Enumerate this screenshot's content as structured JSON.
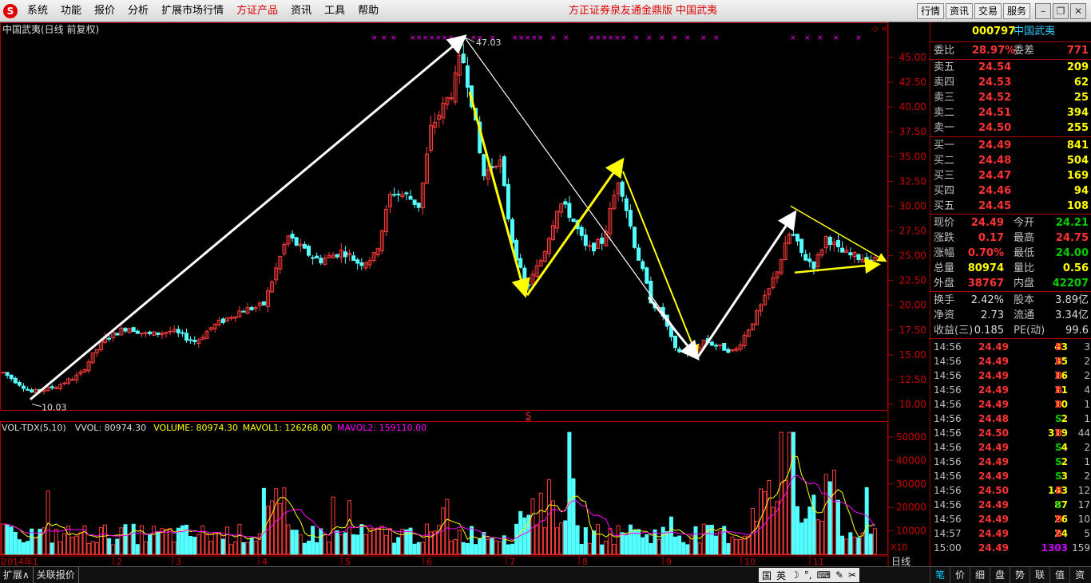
{
  "menu": {
    "items": [
      "系统",
      "功能",
      "报价",
      "分析",
      "扩展市场行情",
      "方证产品",
      "资讯",
      "工具",
      "帮助"
    ],
    "brand": "方正证券泉友通金鼎版",
    "brand_stock": "中国武夷",
    "right_buttons": [
      "行情",
      "资讯",
      "交易",
      "服务"
    ]
  },
  "chart": {
    "title": "中国武夷(日线 前复权)",
    "high_label": "47.03",
    "low_label": "10.03",
    "price_ticks": [
      "45.00",
      "42.50",
      "40.00",
      "37.50",
      "35.00",
      "32.50",
      "30.00",
      "27.50",
      "25.00",
      "22.50",
      "20.00",
      "17.50",
      "15.00",
      "12.50",
      "10.00"
    ],
    "month_labels": [
      "2014年1",
      "2",
      "3",
      "4",
      "5",
      "6",
      "7",
      "8",
      "9",
      "10",
      "11"
    ],
    "vol_ticks": [
      "50000",
      "40000",
      "30000",
      "20000",
      "10000"
    ],
    "vol_legend": {
      "name": "VOL-TDX(5,10)",
      "vvol": "VVOL: 80974.30",
      "volume": "VOLUME: 80974.30",
      "mavol1": "MAVOL1: 126268.00",
      "mavol2": "MAVOL2: 159110.00"
    },
    "unit": "X10",
    "s_marker": "S",
    "colors": {
      "up": "#ff3c3c",
      "down": "#54ffff",
      "ma1": "#ffff00",
      "ma2": "#ff00ff",
      "axis": "#b00000",
      "white_line": "#ffffff",
      "yellow_line": "#ffff00"
    }
  },
  "quote": {
    "code": "000797",
    "name": "中国武夷",
    "weibi": {
      "label": "委比",
      "value": "28.97%",
      "label2": "委差",
      "value2": "771"
    },
    "asks": [
      {
        "label": "卖五",
        "price": "24.54",
        "vol": "209"
      },
      {
        "label": "卖四",
        "price": "24.53",
        "vol": "62"
      },
      {
        "label": "卖三",
        "price": "24.52",
        "vol": "25"
      },
      {
        "label": "卖二",
        "price": "24.51",
        "vol": "394"
      },
      {
        "label": "卖一",
        "price": "24.50",
        "vol": "255"
      }
    ],
    "bids": [
      {
        "label": "买一",
        "price": "24.49",
        "vol": "841"
      },
      {
        "label": "买二",
        "price": "24.48",
        "vol": "504"
      },
      {
        "label": "买三",
        "price": "24.47",
        "vol": "169"
      },
      {
        "label": "买四",
        "price": "24.46",
        "vol": "94"
      },
      {
        "label": "买五",
        "price": "24.45",
        "vol": "108"
      }
    ],
    "stats": [
      {
        "l1": "现价",
        "v1": "24.49",
        "l2": "今开",
        "v2": "24.21"
      },
      {
        "l1": "涨跌",
        "v1": "0.17",
        "l2": "最高",
        "v2": "24.75"
      },
      {
        "l1": "涨幅",
        "v1": "0.70%",
        "l2": "最低",
        "v2": "24.00"
      },
      {
        "l1": "总量",
        "v1": "80974",
        "l2": "量比",
        "v2": "0.56"
      },
      {
        "l1": "外盘",
        "v1": "38767",
        "l2": "内盘",
        "v2": "42207"
      }
    ],
    "stats2": [
      {
        "l1": "换手",
        "v1": "2.42%",
        "l2": "股本",
        "v2": "3.89亿"
      },
      {
        "l1": "净资",
        "v1": "2.73",
        "l2": "流通",
        "v2": "3.34亿"
      },
      {
        "l1": "收益(三)",
        "v1": "0.185",
        "l2": "PE(动)",
        "v2": "99.6"
      }
    ],
    "ticks": [
      {
        "t": "14:56",
        "p": "24.49",
        "v": "43",
        "bs": "B",
        "n": "3"
      },
      {
        "t": "14:56",
        "p": "24.49",
        "v": "35",
        "bs": "B",
        "n": "2"
      },
      {
        "t": "14:56",
        "p": "24.49",
        "v": "16",
        "bs": "B",
        "n": "2"
      },
      {
        "t": "14:56",
        "p": "24.49",
        "v": "11",
        "bs": "B",
        "n": "4"
      },
      {
        "t": "14:56",
        "p": "24.49",
        "v": "10",
        "bs": "B",
        "n": "1"
      },
      {
        "t": "14:56",
        "p": "24.48",
        "v": "2",
        "bs": "S",
        "n": "1"
      },
      {
        "t": "14:56",
        "p": "24.50",
        "v": "319",
        "bs": "B",
        "n": "44"
      },
      {
        "t": "14:56",
        "p": "24.49",
        "v": "4",
        "bs": "S",
        "n": "2"
      },
      {
        "t": "14:56",
        "p": "24.49",
        "v": "2",
        "bs": "S",
        "n": "1"
      },
      {
        "t": "14:56",
        "p": "24.49",
        "v": "3",
        "bs": "S",
        "n": "2"
      },
      {
        "t": "14:56",
        "p": "24.50",
        "v": "143",
        "bs": "B",
        "n": "12"
      },
      {
        "t": "14:56",
        "p": "24.49",
        "v": "87",
        "bs": "S",
        "n": "17"
      },
      {
        "t": "14:56",
        "p": "24.49",
        "v": "26",
        "bs": "B",
        "n": "10"
      },
      {
        "t": "14:57",
        "p": "24.49",
        "v": "24",
        "bs": "B",
        "n": "5"
      },
      {
        "t": "15:00",
        "p": "24.49",
        "v": "1303",
        "bs": "",
        "n": "159"
      }
    ]
  },
  "bottom": {
    "left": [
      "扩展∧",
      "关联报价"
    ],
    "day": "日线",
    "ime": [
      "国",
      "英",
      "☽",
      "°,",
      "⌨",
      "✎",
      "✂"
    ],
    "right_tabs": [
      "笔",
      "价",
      "细",
      "盘",
      "势",
      "联",
      "值",
      "资"
    ]
  }
}
